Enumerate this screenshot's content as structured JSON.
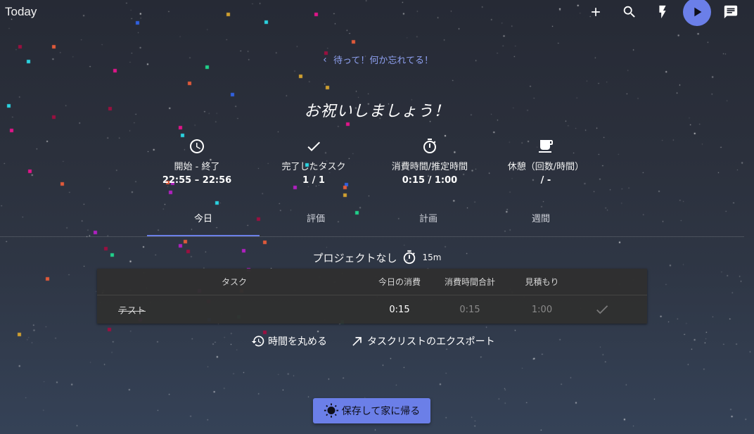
{
  "header": {
    "title": "Today",
    "buttons": [
      {
        "icon": "plus-icon"
      },
      {
        "icon": "search-icon"
      },
      {
        "icon": "bolt-icon"
      },
      {
        "icon": "play-icon"
      },
      {
        "icon": "chat-icon"
      }
    ]
  },
  "back_link": {
    "label": "待って！何か忘れてる！",
    "icon": "chevron-left-icon"
  },
  "celebrate_title": "お祝いしましょう！",
  "stats": [
    {
      "icon": "clock-icon",
      "label": "開始 - 終了",
      "value": "22:55 – 22:56"
    },
    {
      "icon": "check-icon",
      "label": "完了したタスク",
      "value": "1 / 1"
    },
    {
      "icon": "timer-icon",
      "label": "消費時間/推定時間",
      "value": "0:15 / 1:00"
    },
    {
      "icon": "coffee-icon",
      "label": "休憩（回数/時間）",
      "value": "/ -"
    }
  ],
  "tabs": [
    {
      "label": "今日",
      "active": true
    },
    {
      "label": "評価",
      "active": false
    },
    {
      "label": "計画",
      "active": false
    },
    {
      "label": "週間",
      "active": false
    }
  ],
  "project": {
    "name": "プロジェクトなし",
    "time": "15m",
    "icon": "timer-icon"
  },
  "table": {
    "columns": [
      "タスク",
      "今日の消費",
      "消費時間合計",
      "見積もり"
    ],
    "rows": [
      {
        "task": "テスト",
        "today": "0:15",
        "total": "0:15",
        "estimate": "1:00",
        "done": true
      }
    ]
  },
  "actions": {
    "round_time": "時間を丸める",
    "export": "タスクリストのエクスポート"
  },
  "save_button": {
    "label": "保存して家に帰る",
    "icon": "sun-icon"
  },
  "colors": {
    "accent": "#6b7fe8",
    "link": "#8ea0f0",
    "table_bg": "#303030"
  }
}
